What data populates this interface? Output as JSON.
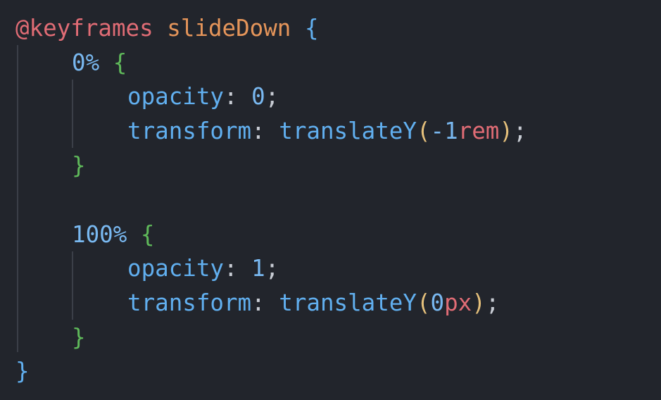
{
  "code": {
    "l1": {
      "at_keyword": "@keyframes",
      "name": "slideDown",
      "brace": "{"
    },
    "l2": {
      "selector": "0%",
      "brace": "{"
    },
    "l3": {
      "property": "opacity",
      "colon": ":",
      "value": "0",
      "semi": ";"
    },
    "l4": {
      "property": "transform",
      "colon": ":",
      "func": "translateY",
      "paren_open": "(",
      "value_num": "-1",
      "unit": "rem",
      "paren_close": ")",
      "semi": ";"
    },
    "l5": {
      "brace": "}"
    },
    "l7": {
      "selector": "100%",
      "brace": "{"
    },
    "l8": {
      "property": "opacity",
      "colon": ":",
      "value": "1",
      "semi": ";"
    },
    "l9": {
      "property": "transform",
      "colon": ":",
      "func": "translateY",
      "paren_open": "(",
      "value_num": "0",
      "unit": "px",
      "paren_close": ")",
      "semi": ";"
    },
    "l10": {
      "brace": "}"
    },
    "l11": {
      "brace": "}"
    }
  },
  "colors": {
    "background": "#22252c",
    "at_keyword": "#e06c75",
    "animation_name": "#e5955a",
    "brace_outer": "#61afef",
    "brace_inner": "#5fb95a",
    "property": "#61afef",
    "value": "#79b8f0",
    "paren": "#e5c07b",
    "unit": "#e06c75",
    "punctuation": "#c8ccd4"
  }
}
